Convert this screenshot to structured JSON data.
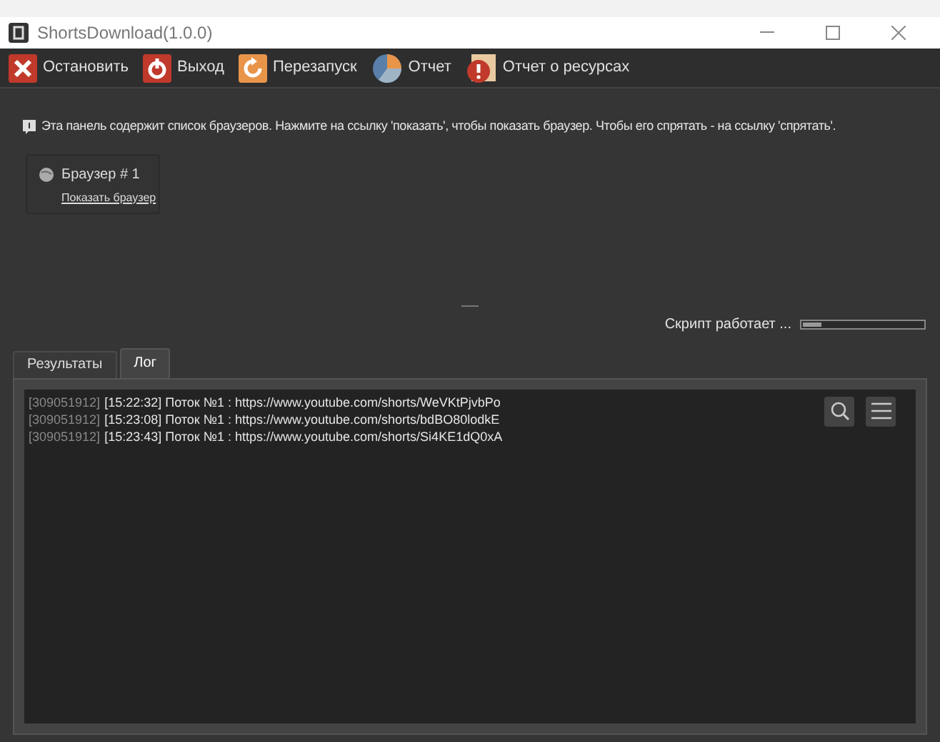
{
  "window": {
    "title": "ShortsDownload(1.0.0)"
  },
  "toolbar": [
    {
      "kind": "stop",
      "label": "Остановить"
    },
    {
      "kind": "exit",
      "label": "Выход"
    },
    {
      "kind": "restart",
      "label": "Перезапуск"
    },
    {
      "kind": "report",
      "label": "Отчет"
    },
    {
      "kind": "resources",
      "label": "Отчет о ресурсах"
    }
  ],
  "info": "Эта панель содержит список браузеров. Нажмите на ссылку 'показать', чтобы показать браузер. Чтобы его спрятать - на ссылку 'спрятать'.",
  "browsers": [
    {
      "name": "Браузер # 1",
      "link": "Показать браузер"
    }
  ],
  "status": {
    "text": "Скрипт работает ...",
    "level": 0.15
  },
  "tabs": [
    {
      "label": "Результаты",
      "selected": false
    },
    {
      "label": "Лог",
      "selected": true
    }
  ],
  "log": [
    {
      "id": "[309051912]",
      "text": "[15:22:32] Поток №1 : https://www.youtube.com/shorts/WeVKtPjvbPo"
    },
    {
      "id": "[309051912]",
      "text": "[15:23:08] Поток №1 : https://www.youtube.com/shorts/bdBO80lodkE"
    },
    {
      "id": "[309051912]",
      "text": "[15:23:43] Поток №1 : https://www.youtube.com/shorts/Si4KE1dQ0xA"
    }
  ]
}
